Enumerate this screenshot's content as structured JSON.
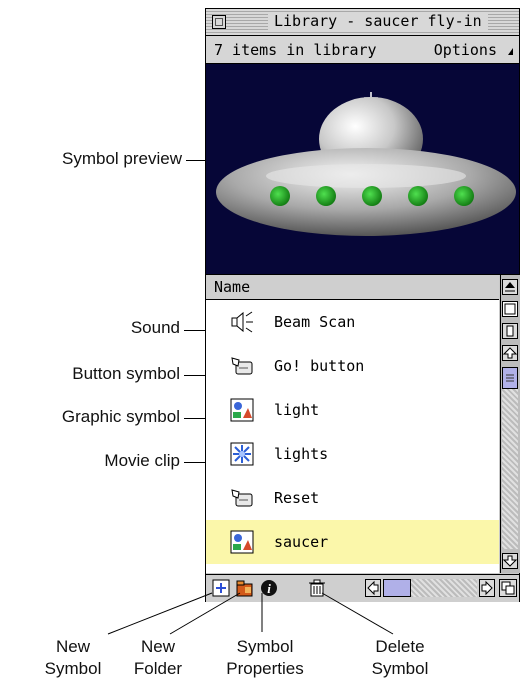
{
  "window": {
    "title": "Library - saucer fly-in",
    "item_count_text": "7 items in library",
    "options_label": "Options",
    "column_header": "Name"
  },
  "items": [
    {
      "label": "Beam Scan",
      "icon": "sound-icon",
      "selected": false
    },
    {
      "label": "Go! button",
      "icon": "button-symbol-icon",
      "selected": false
    },
    {
      "label": "light",
      "icon": "graphic-symbol-icon",
      "selected": false
    },
    {
      "label": "lights",
      "icon": "movie-clip-icon",
      "selected": false
    },
    {
      "label": "Reset",
      "icon": "button-symbol-icon",
      "selected": false
    },
    {
      "label": "saucer",
      "icon": "graphic-symbol-icon",
      "selected": true
    }
  ],
  "callouts": {
    "symbol_preview": "Symbol preview",
    "sound": "Sound",
    "button_symbol": "Button symbol",
    "graphic_symbol": "Graphic symbol",
    "movie_clip": "Movie clip"
  },
  "bottom_callouts": {
    "new_symbol_1": "New",
    "new_symbol_2": "Symbol",
    "new_folder_1": "New",
    "new_folder_2": "Folder",
    "symbol_properties_1": "Symbol",
    "symbol_properties_2": "Properties",
    "delete_symbol_1": "Delete",
    "delete_symbol_2": "Symbol"
  },
  "colors": {
    "preview_background": "#060637",
    "selected_row": "#fbf7aa",
    "saucer_lights": "#1fa61f"
  }
}
